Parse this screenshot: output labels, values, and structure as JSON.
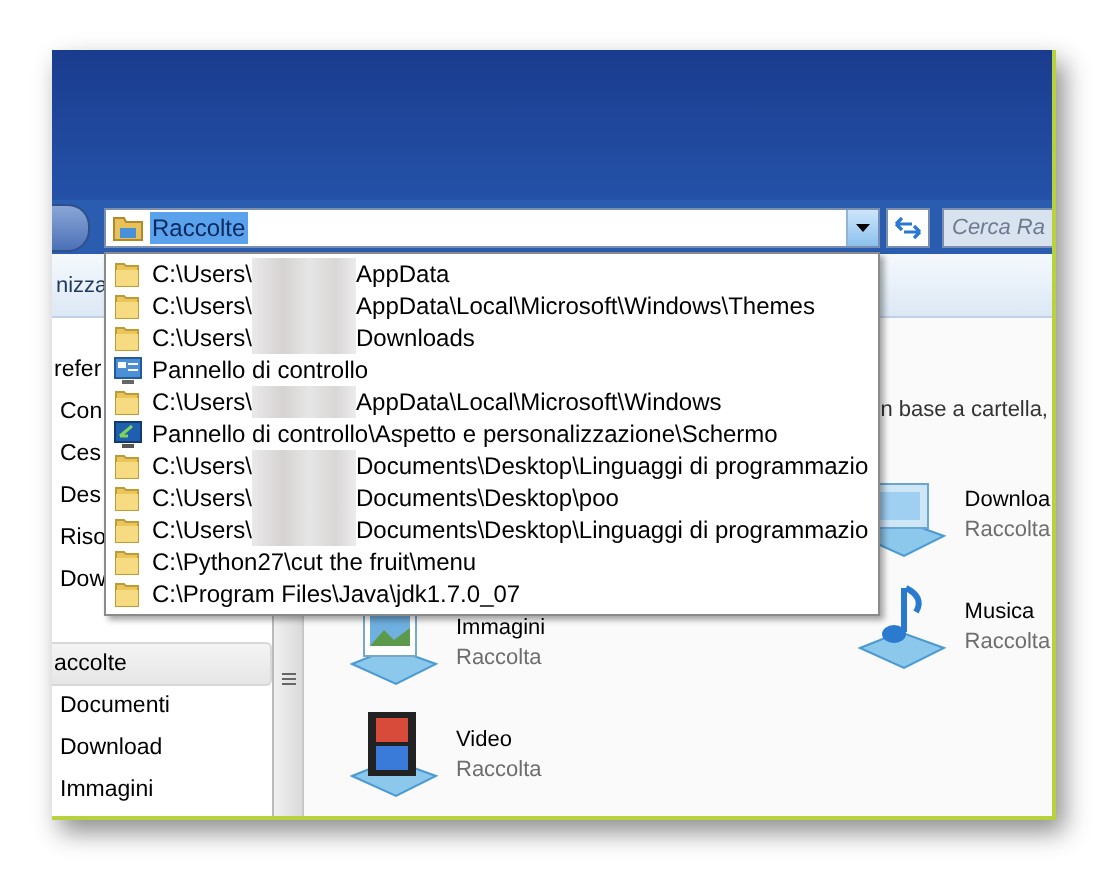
{
  "address_bar": {
    "value": "Raccolte",
    "selected": true
  },
  "search": {
    "placeholder": "Cerca Ra"
  },
  "toolbar": {
    "items": [
      "nizza"
    ]
  },
  "dropdown": {
    "items": [
      {
        "kind": "folder",
        "prefix": "C:\\Users\\",
        "redacted": true,
        "suffix": "AppData"
      },
      {
        "kind": "folder",
        "prefix": "C:\\Users\\",
        "redacted": true,
        "suffix": "AppData\\Local\\Microsoft\\Windows\\Themes"
      },
      {
        "kind": "folder",
        "prefix": "C:\\Users\\",
        "redacted": true,
        "suffix": "Downloads"
      },
      {
        "kind": "control-panel",
        "prefix": "Pannello di controllo",
        "redacted": false
      },
      {
        "kind": "folder",
        "prefix": "C:\\Users\\",
        "redacted": true,
        "suffix": "AppData\\Local\\Microsoft\\Windows"
      },
      {
        "kind": "display",
        "prefix": "Pannello di controllo\\Aspetto e personalizzazione\\Schermo",
        "redacted": false
      },
      {
        "kind": "folder",
        "prefix": "C:\\Users\\",
        "redacted": true,
        "suffix": "Documents\\Desktop\\Linguaggi di programmazio"
      },
      {
        "kind": "folder",
        "prefix": "C:\\Users\\",
        "redacted": true,
        "suffix": "Documents\\Desktop\\poo"
      },
      {
        "kind": "folder",
        "prefix": "C:\\Users\\",
        "redacted": true,
        "suffix": "Documents\\Desktop\\Linguaggi di programmazio"
      },
      {
        "kind": "folder",
        "prefix": "C:\\Python27\\cut the fruit\\menu",
        "redacted": false
      },
      {
        "kind": "folder",
        "prefix": "C:\\Program Files\\Java\\jdk1.7.0_07",
        "redacted": false
      }
    ]
  },
  "nav": {
    "groups": [
      {
        "title": "refer",
        "selected": false,
        "items": [
          "Con",
          "Ces",
          "Des",
          "Riso",
          "Dow"
        ]
      },
      {
        "title": "accolte",
        "selected": true,
        "items": [
          "Documenti",
          "Download",
          "Immagini"
        ]
      }
    ]
  },
  "content": {
    "header": "n base a cartella,",
    "columns": [
      [
        {
          "kind": "pictures",
          "title": "Immagini",
          "subtitle": "Raccolta"
        },
        {
          "kind": "video",
          "title": "Video",
          "subtitle": "Raccolta"
        }
      ],
      [
        {
          "kind": "downloads",
          "title": "Downloa",
          "subtitle": "Raccolta"
        },
        {
          "kind": "music",
          "title": "Musica",
          "subtitle": "Raccolta"
        }
      ]
    ]
  }
}
